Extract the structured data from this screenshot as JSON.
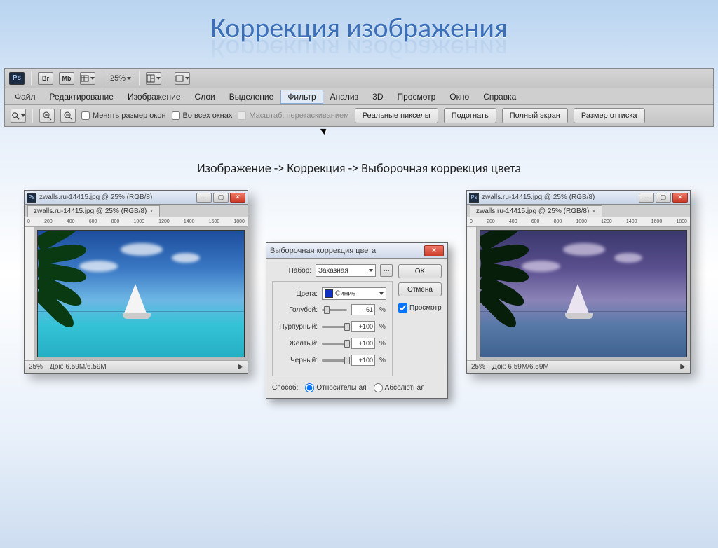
{
  "slide": {
    "title": "Коррекция изображения",
    "breadcrumb": "Изображение -> Коррекция -> Выборочная коррекция цвета"
  },
  "top_icons": {
    "ps": "Ps",
    "br": "Br",
    "mb": "Mb"
  },
  "zoom_pct": "25%",
  "menubar": [
    "Файл",
    "Редактирование",
    "Изображение",
    "Слои",
    "Выделение",
    "Фильтр",
    "Анализ",
    "3D",
    "Просмотр",
    "Окно",
    "Справка"
  ],
  "menubar_hover_index": 5,
  "options": {
    "resize_windows": "Менять размер окон",
    "all_windows": "Во всех окнах",
    "disabled_scrub": "Масштаб. перетаскиванием",
    "btn_actual": "Реальные пикселы",
    "btn_fit": "Подогнать",
    "btn_full": "Полный экран",
    "btn_print": "Размер оттиска"
  },
  "doc_window": {
    "title_tab": "zwalls.ru-14415.jpg @ 25% (RGB/8)",
    "ruler_ticks": [
      "0",
      "200",
      "400",
      "600",
      "800",
      "1000",
      "1200",
      "1400",
      "1600",
      "1800"
    ],
    "status_zoom": "25%",
    "status_doc": "Док: 6.59M/6.59M"
  },
  "dialog": {
    "title": "Выборочная коррекция цвета",
    "preset_label": "Набор:",
    "preset_value": "Заказная",
    "colors_label": "Цвета:",
    "colors_value": "Синие",
    "sliders": [
      {
        "label": "Голубой:",
        "value": "-61",
        "thumb_pct": 20
      },
      {
        "label": "Пурпурный:",
        "value": "+100",
        "thumb_pct": 100
      },
      {
        "label": "Желтый:",
        "value": "+100",
        "thumb_pct": 100
      },
      {
        "label": "Черный:",
        "value": "+100",
        "thumb_pct": 100
      }
    ],
    "unit": "%",
    "ok": "OK",
    "cancel": "Отмена",
    "preview": "Просмотр",
    "method_label": "Способ:",
    "method_relative": "Относительная",
    "method_absolute": "Абсолютная"
  }
}
